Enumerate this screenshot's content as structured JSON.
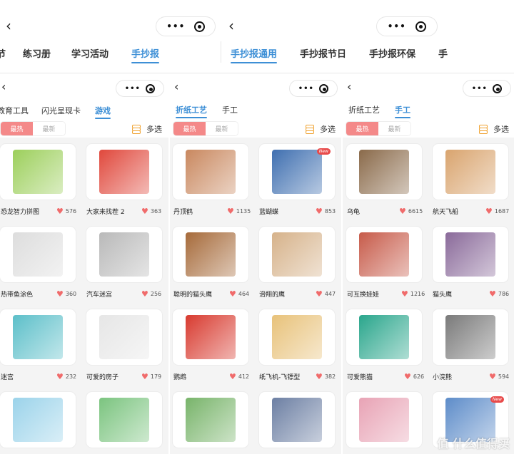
{
  "panel_top_left": {
    "tabs": [
      "节",
      "练习册",
      "学习活动",
      "手抄报"
    ]
  },
  "panel_top_right": {
    "tabs": [
      "手抄报通用",
      "手抄报节日",
      "手抄报环保",
      "手"
    ]
  },
  "panels": [
    {
      "tabs": [
        "教育工具",
        "闪光呈现卡",
        "游戏"
      ],
      "segment": [
        "最热",
        "最新"
      ],
      "multi_label": "多选",
      "items": [
        {
          "title": "恐龙智力拼图",
          "likes": "576",
          "color": "#9ccf5b"
        },
        {
          "title": "大家来找茬 2",
          "likes": "363",
          "color": "#e0483c"
        },
        {
          "title": "热带鱼涂色",
          "likes": "360",
          "color": "#dddddd"
        },
        {
          "title": "汽车迷宫",
          "likes": "256",
          "color": "#b9b9b9"
        },
        {
          "title": "迷宫",
          "likes": "232",
          "color": "#5cbfc9"
        },
        {
          "title": "可爱的房子",
          "likes": "179",
          "color": "#e6e6e6"
        },
        {
          "title": "",
          "likes": "",
          "color": "#9bd3ea"
        },
        {
          "title": "",
          "likes": "",
          "color": "#7bc47f"
        }
      ]
    },
    {
      "tabs": [
        "折纸工艺",
        "手工"
      ],
      "segment": [
        "最热",
        "最新"
      ],
      "multi_label": "多选",
      "items": [
        {
          "title": "丹顶鹤",
          "likes": "1135",
          "color": "#c9885f",
          "new": ""
        },
        {
          "title": "蓝蝴蝶",
          "likes": "853",
          "color": "#3f6fb0",
          "new": "New"
        },
        {
          "title": "聪明的猫头鹰",
          "likes": "464",
          "color": "#a66a3a",
          "new": ""
        },
        {
          "title": "滑翔的鹰",
          "likes": "447",
          "color": "#d6b28a",
          "new": ""
        },
        {
          "title": "鹦鹉",
          "likes": "412",
          "color": "#d83a2f",
          "new": ""
        },
        {
          "title": "纸飞机-飞镖型",
          "likes": "382",
          "color": "#e8c27a",
          "new": ""
        },
        {
          "title": "",
          "likes": "",
          "color": "#78b46a",
          "new": ""
        },
        {
          "title": "",
          "likes": "",
          "color": "#6c7fa3",
          "new": ""
        }
      ]
    },
    {
      "tabs": [
        "折纸工艺",
        "手工"
      ],
      "segment": [
        "最热",
        "最新"
      ],
      "multi_label": "多选",
      "items": [
        {
          "title": "乌龟",
          "likes": "6615",
          "color": "#8a6a4a",
          "new": ""
        },
        {
          "title": "航天飞船",
          "likes": "1687",
          "color": "#d9a46e",
          "new": ""
        },
        {
          "title": "可互换娃娃",
          "likes": "1216",
          "color": "#c75b4a",
          "new": ""
        },
        {
          "title": "猫头鹰",
          "likes": "786",
          "color": "#8a6a9a",
          "new": ""
        },
        {
          "title": "可爱熊猫",
          "likes": "626",
          "color": "#2aa68c",
          "new": ""
        },
        {
          "title": "小浣熊",
          "likes": "594",
          "color": "#7a7a7a",
          "new": ""
        },
        {
          "title": "",
          "likes": "",
          "color": "#e8a3b5",
          "new": ""
        },
        {
          "title": "",
          "likes": "",
          "color": "#5d8cc9",
          "new": "New"
        }
      ]
    }
  ],
  "watermark": "值 什么值得买"
}
